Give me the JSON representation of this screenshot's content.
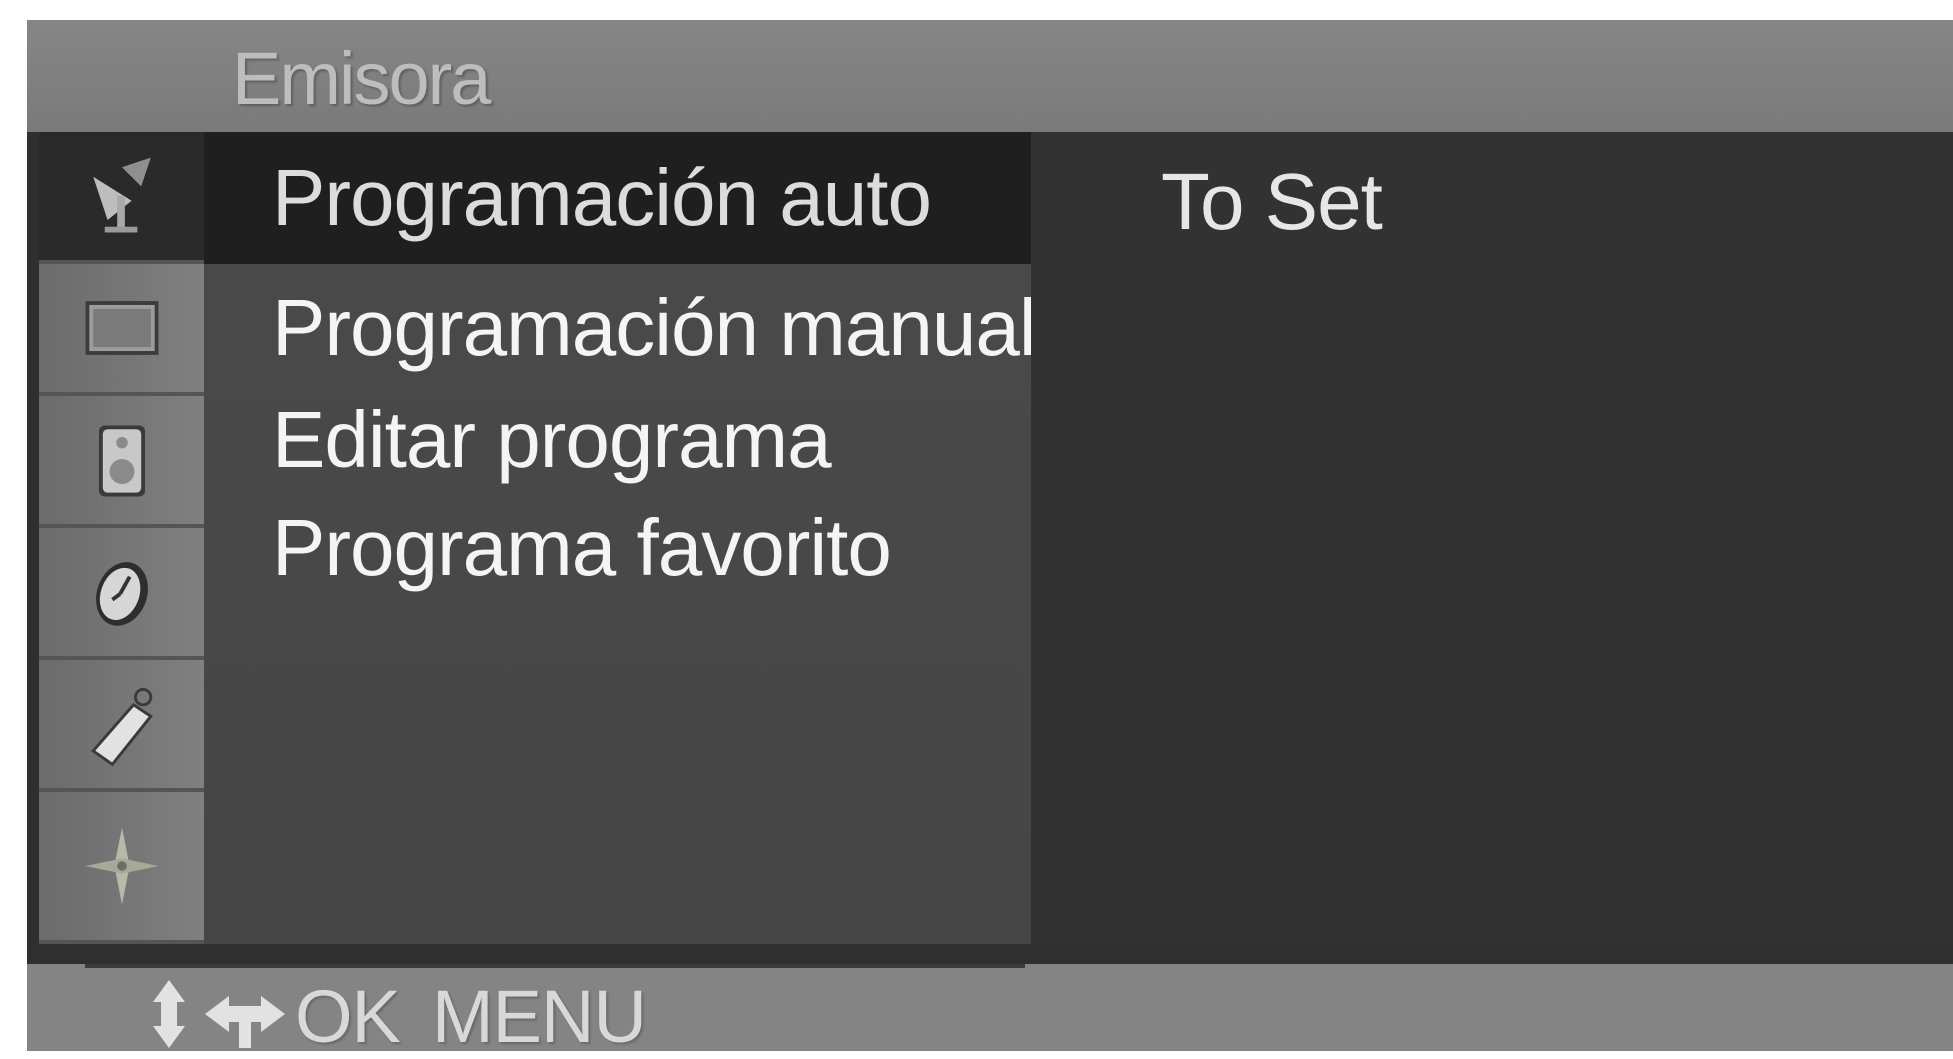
{
  "menu": {
    "title": "Emisora"
  },
  "sidebar": {
    "tabs": [
      {
        "icon": "satellite-dish-icon",
        "active": true
      },
      {
        "icon": "picture-icon",
        "active": false
      },
      {
        "icon": "speaker-icon",
        "active": false
      },
      {
        "icon": "clock-icon",
        "active": false
      },
      {
        "icon": "tag-icon",
        "active": false
      },
      {
        "icon": "compass-icon",
        "active": false
      }
    ]
  },
  "submenu": {
    "items": [
      {
        "label": "Programación auto",
        "selected": true
      },
      {
        "label": "Programación manual",
        "selected": false
      },
      {
        "label": "Editar programa",
        "selected": false
      },
      {
        "label": "Programa favorito",
        "selected": false
      }
    ]
  },
  "value_pane": {
    "text": "To Set"
  },
  "footer": {
    "ok_label": "OK",
    "menu_label": "MENU"
  }
}
